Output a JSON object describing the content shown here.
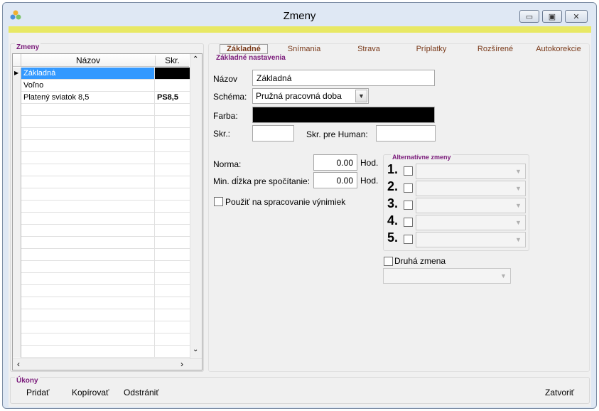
{
  "window": {
    "title": "Zmeny"
  },
  "left_group": {
    "title": "Zmeny",
    "columns": [
      "Názov",
      "Skr."
    ],
    "rows": [
      {
        "name": "Základná",
        "abbr": ""
      },
      {
        "name": "Voľno",
        "abbr": ""
      },
      {
        "name": "Platený sviatok 8,5",
        "abbr": "PS8,5"
      }
    ]
  },
  "tabs": [
    "Základné",
    "Snímania",
    "Strava",
    "Príplatky",
    "Rozšírené",
    "Autokorekcie"
  ],
  "basic": {
    "group_title": "Základné nastavenia",
    "name_label": "Názov",
    "name_value": "Základná",
    "scheme_label": "Schéma:",
    "scheme_value": "Pružná pracovná doba",
    "color_label": "Farba:",
    "color_value": "#000000",
    "abbr_label": "Skr.:",
    "abbr_value": "",
    "human_label": "Skr. pre Human:",
    "human_value": "",
    "norm_label": "Norma:",
    "norm_value": "0.00",
    "norm_unit": "Hod.",
    "min_label": "Min. dĺžka pre spočítanie:",
    "min_value": "0.00",
    "min_unit": "Hod.",
    "exceptions_label": "Použiť na spracovanie výnimiek"
  },
  "alternative": {
    "title": "Alternatívne zmeny",
    "items": [
      "1.",
      "2.",
      "3.",
      "4.",
      "5."
    ]
  },
  "second_shift": {
    "label": "Druhá zmena"
  },
  "actions": {
    "title": "Úkony",
    "add": "Pridať",
    "copy": "Kopírovať",
    "remove": "Odstrániť",
    "close": "Zatvoriť"
  },
  "colors": {
    "accent_bar": "#e8e864",
    "group_title": "#7a1a7a",
    "tab_text": "#7a3a1a",
    "selection": "#3399ff"
  }
}
